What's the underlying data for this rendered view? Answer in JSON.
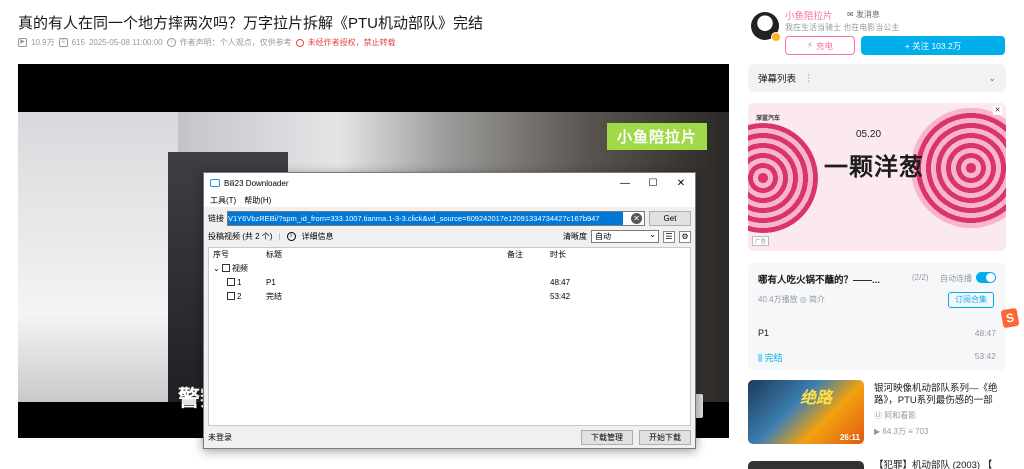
{
  "video": {
    "title": "真的有人在同一个地方摔两次吗？万字拉片拆解《PTU机动部队》完结",
    "views": "10.9万",
    "danmaku_count": "615",
    "publish_time": "2025-05-08 11:00:00",
    "author_statement": "作者声明：个人观点，仅供参考",
    "no_repost": "未经作者授权，禁止转载",
    "watermark": "小鱼陪拉片",
    "subtitle": "警察"
  },
  "downloader": {
    "window_title": "Bili23 Downloader",
    "window_controls": [
      "—",
      "☐",
      "✕"
    ],
    "menu": [
      "工具(T)",
      "帮助(H)"
    ],
    "link_label": "链接",
    "link_value": "V1Y6VbzREBi/?spm_id_from=333.1007.tianma.1-3-3.click&vd_source=609242017e12091334734427c167b947",
    "get_button": "Get",
    "info_text": "投稿视频 (共 2 个)",
    "detail_label": "详细信息",
    "quality_label": "清晰度",
    "quality_value": "自动",
    "columns": [
      "序号",
      "标题",
      "备注",
      "时长"
    ],
    "group_label": "视频",
    "rows": [
      {
        "index": "1",
        "title": "P1",
        "duration": "48:47"
      },
      {
        "index": "2",
        "title": "完结",
        "duration": "53:42"
      }
    ],
    "login_status": "未登录",
    "manage_button": "下载管理",
    "start_button": "开始下载"
  },
  "uploader": {
    "name": "小鱼陪拉片",
    "message_label": "发消息",
    "description": "我在生活当骑士 也在电影当公主",
    "charge_label": "充电",
    "follow_label": "+ 关注 103.2万"
  },
  "danmaku_list": {
    "label": "弹幕列表",
    "dots": "⋮"
  },
  "ad": {
    "brand": "深蓝汽车",
    "date": "05.20",
    "headline": "一颗洋葱",
    "tag": "广告"
  },
  "series": {
    "title": "哪有人吃火锅不蘸的？——...",
    "count": "(2/2)",
    "autoplay_label": "自动连播",
    "stats": "40.4万播放  ◎ 简介",
    "collect_label": "订阅合集",
    "episodes": [
      {
        "title": "P1",
        "duration": "48:47"
      },
      {
        "title": "完结",
        "duration": "53:42"
      }
    ]
  },
  "recommend": [
    {
      "title": "银河映像机动部队系列—《绝路》，PTU系列最伤感的一部",
      "thumb_text": "绝路",
      "up": "阿和看影",
      "views": "64.3万",
      "danmaku": "703",
      "duration": "26:11"
    },
    {
      "title": "【犯罪】机动部队 (2003) 【"
    }
  ],
  "colors": {
    "accent": "#00aeec",
    "pink": "#fb7299",
    "selection": "#0078d7"
  }
}
